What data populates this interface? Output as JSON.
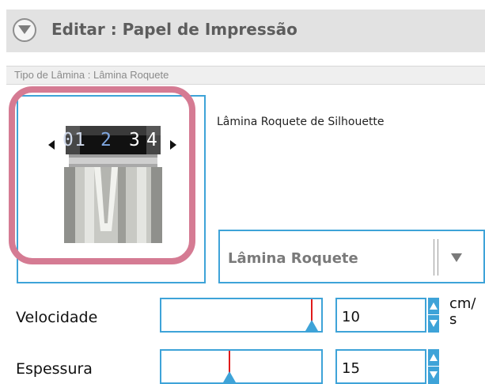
{
  "header": {
    "title": "Editar : Papel de Impressão",
    "collapse_icon": "chevron-down-circle-icon"
  },
  "blade_type_bar": {
    "text": "Tipo de Lâmina : Lâmina Roquete"
  },
  "blade_panel": {
    "image": "roquete-blade-image",
    "dial_digits": [
      "0",
      "1",
      "2",
      "3",
      "4"
    ],
    "highlight_color": "#d57b93"
  },
  "blade_description": "Lâmina Roquete de Silhouette",
  "blade_select": {
    "selected": "Lâmina Roquete",
    "arrow_icon": "triangle-down-icon"
  },
  "speed": {
    "label": "Velocidade",
    "value": "10",
    "unit": "cm/ s",
    "level": 10,
    "max": 10
  },
  "thickness": {
    "label": "Espessura",
    "value": "15",
    "level": 15,
    "max": 33
  },
  "colors": {
    "accent": "#3ea3d8",
    "marker": "#e01b1b",
    "header_bg": "#e2e2e2"
  }
}
